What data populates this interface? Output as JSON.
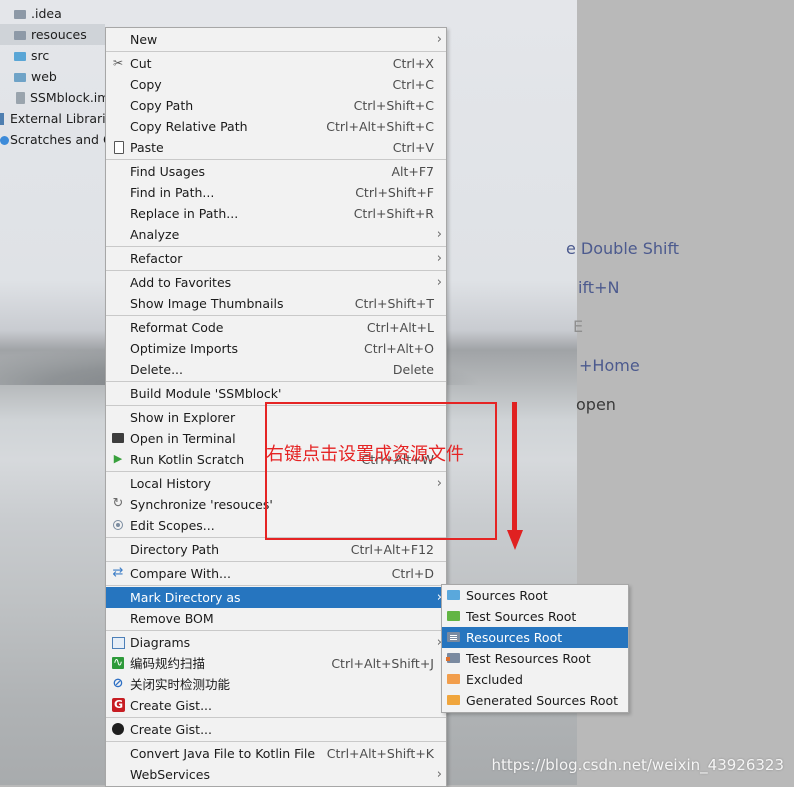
{
  "tree": [
    {
      "label": ".idea",
      "icon": "folder-icon"
    },
    {
      "label": "resouces",
      "icon": "folder-icon",
      "selected": true
    },
    {
      "label": "src",
      "icon": "source-folder-icon"
    },
    {
      "label": "web",
      "icon": "web-folder-icon"
    },
    {
      "label": "SSMblock.iml",
      "icon": "iml-file-icon"
    },
    {
      "label": "External Libraries",
      "icon": "library-icon"
    },
    {
      "label": "Scratches and Consoles",
      "icon": "scratch-icon"
    }
  ],
  "hints": [
    "e Double Shift",
    "ift+N",
    "E",
    "+Home",
    "open"
  ],
  "menu": {
    "items": [
      {
        "label": "New",
        "shortcut": "",
        "submenu": true,
        "icon": ""
      },
      {
        "label": "Cut",
        "shortcut": "Ctrl+X",
        "icon": "scissors-icon"
      },
      {
        "label": "Copy",
        "shortcut": "Ctrl+C",
        "icon": ""
      },
      {
        "label": "Copy Path",
        "shortcut": "Ctrl+Shift+C",
        "icon": ""
      },
      {
        "label": "Copy Relative Path",
        "shortcut": "Ctrl+Alt+Shift+C",
        "icon": ""
      },
      {
        "label": "Paste",
        "shortcut": "Ctrl+V",
        "icon": "paste-icon"
      },
      {
        "label": "Find Usages",
        "shortcut": "Alt+F7",
        "icon": ""
      },
      {
        "label": "Find in Path...",
        "shortcut": "Ctrl+Shift+F",
        "icon": ""
      },
      {
        "label": "Replace in Path...",
        "shortcut": "Ctrl+Shift+R",
        "icon": ""
      },
      {
        "label": "Analyze",
        "shortcut": "",
        "submenu": true,
        "icon": ""
      },
      {
        "label": "Refactor",
        "shortcut": "",
        "submenu": true,
        "icon": ""
      },
      {
        "label": "Add to Favorites",
        "shortcut": "",
        "submenu": true,
        "icon": ""
      },
      {
        "label": "Show Image Thumbnails",
        "shortcut": "Ctrl+Shift+T",
        "icon": ""
      },
      {
        "label": "Reformat Code",
        "shortcut": "Ctrl+Alt+L",
        "icon": ""
      },
      {
        "label": "Optimize Imports",
        "shortcut": "Ctrl+Alt+O",
        "icon": ""
      },
      {
        "label": "Delete...",
        "shortcut": "Delete",
        "icon": ""
      },
      {
        "label": "Build Module 'SSMblock'",
        "shortcut": "",
        "icon": ""
      },
      {
        "label": "Show in Explorer",
        "shortcut": "",
        "icon": ""
      },
      {
        "label": "Open in Terminal",
        "shortcut": "",
        "icon": "terminal-icon"
      },
      {
        "label": "Run Kotlin Scratch",
        "shortcut": "Ctrl+Alt+W",
        "icon": "play-icon"
      },
      {
        "label": "Local History",
        "shortcut": "",
        "submenu": true,
        "icon": ""
      },
      {
        "label": "Synchronize 'resouces'",
        "shortcut": "",
        "icon": "sync-icon"
      },
      {
        "label": "Edit Scopes...",
        "shortcut": "",
        "icon": "scope-icon"
      },
      {
        "label": "Directory Path",
        "shortcut": "Ctrl+Alt+F12",
        "icon": ""
      },
      {
        "label": "Compare With...",
        "shortcut": "Ctrl+D",
        "icon": "compare-icon"
      },
      {
        "label": "Mark Directory as",
        "shortcut": "",
        "submenu": true,
        "active": true,
        "icon": ""
      },
      {
        "label": "Remove BOM",
        "shortcut": "",
        "icon": ""
      },
      {
        "label": "Diagrams",
        "shortcut": "",
        "submenu": true,
        "icon": "diagram-icon"
      },
      {
        "label": "编码规约扫描",
        "shortcut": "Ctrl+Alt+Shift+J",
        "icon": "code-scan-icon"
      },
      {
        "label": "关闭实时检测功能",
        "shortcut": "",
        "icon": "ban-icon"
      },
      {
        "label": "Create Gist...",
        "shortcut": "",
        "icon": "gitee-icon"
      },
      {
        "label": "Create Gist...",
        "shortcut": "",
        "icon": "github-icon"
      },
      {
        "label": "Convert Java File to Kotlin File",
        "shortcut": "Ctrl+Alt+Shift+K",
        "icon": ""
      },
      {
        "label": "WebServices",
        "shortcut": "",
        "submenu": true,
        "icon": ""
      }
    ]
  },
  "submenu": {
    "items": [
      {
        "label": "Sources Root",
        "icon": "sources-root-icon"
      },
      {
        "label": "Test Sources Root",
        "icon": "test-sources-root-icon"
      },
      {
        "label": "Resources Root",
        "icon": "resources-root-icon",
        "active": true
      },
      {
        "label": "Test Resources Root",
        "icon": "test-resources-root-icon"
      },
      {
        "label": "Excluded",
        "icon": "excluded-icon"
      },
      {
        "label": "Generated Sources Root",
        "icon": "generated-sources-root-icon"
      }
    ]
  },
  "annotation": {
    "text": "右键点击设置成资源文件"
  },
  "watermark": "https://blog.csdn.net/weixin_43926323",
  "colors": {
    "selection": "#2675bf",
    "annotation": "#e52424",
    "hint_text": "#4c5a8e"
  }
}
